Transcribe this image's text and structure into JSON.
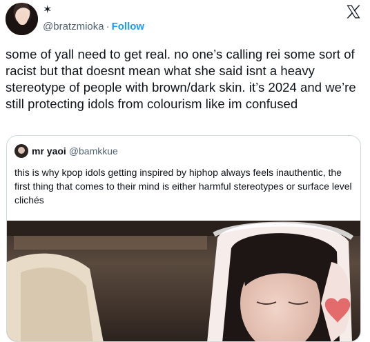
{
  "author": {
    "display_name": "✶",
    "handle": "@bratzmioka",
    "separator": "·",
    "follow_label": "Follow"
  },
  "tweet": {
    "text": "some of yall need to get real. no one’s calling rei some sort of racist but that doesnt mean what she said isnt a heavy stereotype of people with brown/dark skin. it’s 2024 and we’re still protecting idols from colourism like im confused"
  },
  "quoted": {
    "display_name": "mr yaoi",
    "handle": "@bamkkue",
    "text": "this is why kpop idols getting inspired by hiphop always feels inauthentic, the first thing that comes to their mind is either harmful stereotypes or surface level clichés"
  },
  "icons": {
    "brand": "x-logo-icon"
  },
  "colors": {
    "link": "#1d9bf0",
    "muted": "#536471",
    "border": "#cfd9de"
  }
}
